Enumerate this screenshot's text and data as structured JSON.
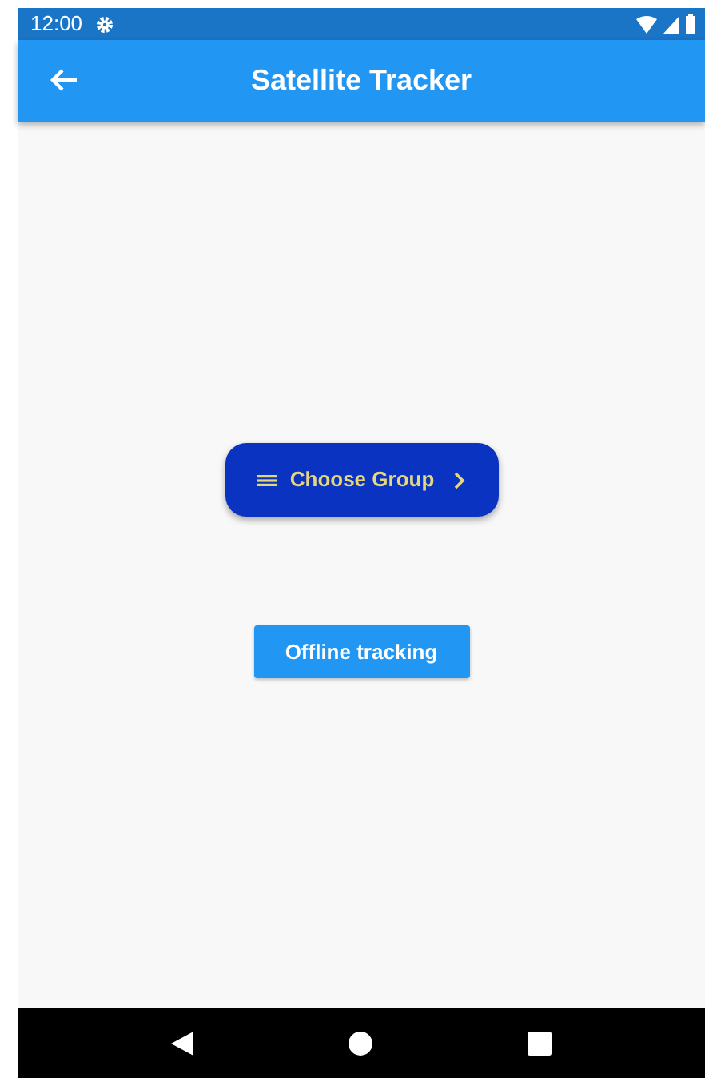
{
  "status_bar": {
    "time": "12:00"
  },
  "app_bar": {
    "title": "Satellite Tracker"
  },
  "buttons": [
    {
      "kind": "group",
      "label": "Choose Group"
    },
    {
      "kind": "plain",
      "label": "Offline tracking"
    }
  ]
}
